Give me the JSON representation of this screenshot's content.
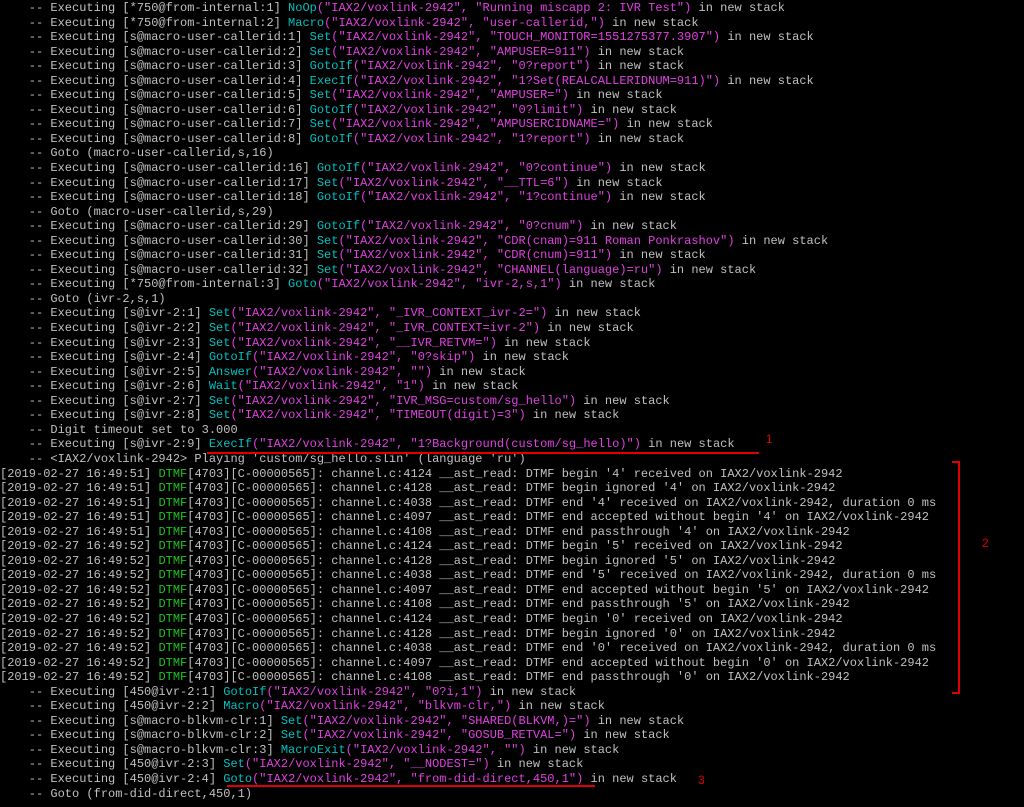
{
  "console": {
    "lines": [
      [
        {
          "t": "    -- Executing [*750@from-internal:1] ",
          "c": "plain"
        },
        {
          "t": "NoOp",
          "c": "app"
        },
        {
          "t": "(\"IAX2/voxlink-2942\", \"Running miscapp 2: IVR Test\")",
          "c": "str"
        },
        {
          "t": " in new stack",
          "c": "plain"
        }
      ],
      [
        {
          "t": "    -- Executing [*750@from-internal:2] ",
          "c": "plain"
        },
        {
          "t": "Macro",
          "c": "app"
        },
        {
          "t": "(\"IAX2/voxlink-2942\", \"user-callerid,\")",
          "c": "str"
        },
        {
          "t": " in new stack",
          "c": "plain"
        }
      ],
      [
        {
          "t": "    -- Executing [s@macro-user-callerid:1] ",
          "c": "plain"
        },
        {
          "t": "Set",
          "c": "app"
        },
        {
          "t": "(\"IAX2/voxlink-2942\", \"TOUCH_MONITOR=1551275377.3907\")",
          "c": "str"
        },
        {
          "t": " in new stack",
          "c": "plain"
        }
      ],
      [
        {
          "t": "    -- Executing [s@macro-user-callerid:2] ",
          "c": "plain"
        },
        {
          "t": "Set",
          "c": "app"
        },
        {
          "t": "(\"IAX2/voxlink-2942\", \"AMPUSER=911\")",
          "c": "str"
        },
        {
          "t": " in new stack",
          "c": "plain"
        }
      ],
      [
        {
          "t": "    -- Executing [s@macro-user-callerid:3] ",
          "c": "plain"
        },
        {
          "t": "GotoIf",
          "c": "app"
        },
        {
          "t": "(\"IAX2/voxlink-2942\", \"0?report\")",
          "c": "str"
        },
        {
          "t": " in new stack",
          "c": "plain"
        }
      ],
      [
        {
          "t": "    -- Executing [s@macro-user-callerid:4] ",
          "c": "plain"
        },
        {
          "t": "ExecIf",
          "c": "app"
        },
        {
          "t": "(\"IAX2/voxlink-2942\", \"1?Set(REALCALLERIDNUM=911)\")",
          "c": "str"
        },
        {
          "t": " in new stack",
          "c": "plain"
        }
      ],
      [
        {
          "t": "    -- Executing [s@macro-user-callerid:5] ",
          "c": "plain"
        },
        {
          "t": "Set",
          "c": "app"
        },
        {
          "t": "(\"IAX2/voxlink-2942\", \"AMPUSER=\")",
          "c": "str"
        },
        {
          "t": " in new stack",
          "c": "plain"
        }
      ],
      [
        {
          "t": "    -- Executing [s@macro-user-callerid:6] ",
          "c": "plain"
        },
        {
          "t": "GotoIf",
          "c": "app"
        },
        {
          "t": "(\"IAX2/voxlink-2942\", \"0?limit\")",
          "c": "str"
        },
        {
          "t": " in new stack",
          "c": "plain"
        }
      ],
      [
        {
          "t": "    -- Executing [s@macro-user-callerid:7] ",
          "c": "plain"
        },
        {
          "t": "Set",
          "c": "app"
        },
        {
          "t": "(\"IAX2/voxlink-2942\", \"AMPUSERCIDNAME=\")",
          "c": "str"
        },
        {
          "t": " in new stack",
          "c": "plain"
        }
      ],
      [
        {
          "t": "    -- Executing [s@macro-user-callerid:8] ",
          "c": "plain"
        },
        {
          "t": "GotoIf",
          "c": "app"
        },
        {
          "t": "(\"IAX2/voxlink-2942\", \"1?report\")",
          "c": "str"
        },
        {
          "t": " in new stack",
          "c": "plain"
        }
      ],
      [
        {
          "t": "    -- Goto (macro-user-callerid,s,16)",
          "c": "plain"
        }
      ],
      [
        {
          "t": "    -- Executing [s@macro-user-callerid:16] ",
          "c": "plain"
        },
        {
          "t": "GotoIf",
          "c": "app"
        },
        {
          "t": "(\"IAX2/voxlink-2942\", \"0?continue\")",
          "c": "str"
        },
        {
          "t": " in new stack",
          "c": "plain"
        }
      ],
      [
        {
          "t": "    -- Executing [s@macro-user-callerid:17] ",
          "c": "plain"
        },
        {
          "t": "Set",
          "c": "app"
        },
        {
          "t": "(\"IAX2/voxlink-2942\", \"__TTL=6\")",
          "c": "str"
        },
        {
          "t": " in new stack",
          "c": "plain"
        }
      ],
      [
        {
          "t": "    -- Executing [s@macro-user-callerid:18] ",
          "c": "plain"
        },
        {
          "t": "GotoIf",
          "c": "app"
        },
        {
          "t": "(\"IAX2/voxlink-2942\", \"1?continue\")",
          "c": "str"
        },
        {
          "t": " in new stack",
          "c": "plain"
        }
      ],
      [
        {
          "t": "    -- Goto (macro-user-callerid,s,29)",
          "c": "plain"
        }
      ],
      [
        {
          "t": "    -- Executing [s@macro-user-callerid:29] ",
          "c": "plain"
        },
        {
          "t": "GotoIf",
          "c": "app"
        },
        {
          "t": "(\"IAX2/voxlink-2942\", \"0?cnum\")",
          "c": "str"
        },
        {
          "t": " in new stack",
          "c": "plain"
        }
      ],
      [
        {
          "t": "    -- Executing [s@macro-user-callerid:30] ",
          "c": "plain"
        },
        {
          "t": "Set",
          "c": "app"
        },
        {
          "t": "(\"IAX2/voxlink-2942\", \"CDR(cnam)=911 Roman Ponkrashov\")",
          "c": "str"
        },
        {
          "t": " in new stack",
          "c": "plain"
        }
      ],
      [
        {
          "t": "    -- Executing [s@macro-user-callerid:31] ",
          "c": "plain"
        },
        {
          "t": "Set",
          "c": "app"
        },
        {
          "t": "(\"IAX2/voxlink-2942\", \"CDR(cnum)=911\")",
          "c": "str"
        },
        {
          "t": " in new stack",
          "c": "plain"
        }
      ],
      [
        {
          "t": "    -- Executing [s@macro-user-callerid:32] ",
          "c": "plain"
        },
        {
          "t": "Set",
          "c": "app"
        },
        {
          "t": "(\"IAX2/voxlink-2942\", \"CHANNEL(language)=ru\")",
          "c": "str"
        },
        {
          "t": " in new stack",
          "c": "plain"
        }
      ],
      [
        {
          "t": "    -- Executing [*750@from-internal:3] ",
          "c": "plain"
        },
        {
          "t": "Goto",
          "c": "app"
        },
        {
          "t": "(\"IAX2/voxlink-2942\", \"ivr-2,s,1\")",
          "c": "str"
        },
        {
          "t": " in new stack",
          "c": "plain"
        }
      ],
      [
        {
          "t": "    -- Goto (ivr-2,s,1)",
          "c": "plain"
        }
      ],
      [
        {
          "t": "    -- Executing [s@ivr-2:1] ",
          "c": "plain"
        },
        {
          "t": "Set",
          "c": "app"
        },
        {
          "t": "(\"IAX2/voxlink-2942\", \"_IVR_CONTEXT_ivr-2=\")",
          "c": "str"
        },
        {
          "t": " in new stack",
          "c": "plain"
        }
      ],
      [
        {
          "t": "    -- Executing [s@ivr-2:2] ",
          "c": "plain"
        },
        {
          "t": "Set",
          "c": "app"
        },
        {
          "t": "(\"IAX2/voxlink-2942\", \"_IVR_CONTEXT=ivr-2\")",
          "c": "str"
        },
        {
          "t": " in new stack",
          "c": "plain"
        }
      ],
      [
        {
          "t": "    -- Executing [s@ivr-2:3] ",
          "c": "plain"
        },
        {
          "t": "Set",
          "c": "app"
        },
        {
          "t": "(\"IAX2/voxlink-2942\", \"__IVR_RETVM=\")",
          "c": "str"
        },
        {
          "t": " in new stack",
          "c": "plain"
        }
      ],
      [
        {
          "t": "    -- Executing [s@ivr-2:4] ",
          "c": "plain"
        },
        {
          "t": "GotoIf",
          "c": "app"
        },
        {
          "t": "(\"IAX2/voxlink-2942\", \"0?skip\")",
          "c": "str"
        },
        {
          "t": " in new stack",
          "c": "plain"
        }
      ],
      [
        {
          "t": "    -- Executing [s@ivr-2:5] ",
          "c": "plain"
        },
        {
          "t": "Answer",
          "c": "app"
        },
        {
          "t": "(\"IAX2/voxlink-2942\", \"\")",
          "c": "str"
        },
        {
          "t": " in new stack",
          "c": "plain"
        }
      ],
      [
        {
          "t": "    -- Executing [s@ivr-2:6] ",
          "c": "plain"
        },
        {
          "t": "Wait",
          "c": "app"
        },
        {
          "t": "(\"IAX2/voxlink-2942\", \"1\")",
          "c": "str"
        },
        {
          "t": " in new stack",
          "c": "plain"
        }
      ],
      [
        {
          "t": "    -- Executing [s@ivr-2:7] ",
          "c": "plain"
        },
        {
          "t": "Set",
          "c": "app"
        },
        {
          "t": "(\"IAX2/voxlink-2942\", \"IVR_MSG=custom/sg_hello\")",
          "c": "str"
        },
        {
          "t": " in new stack",
          "c": "plain"
        }
      ],
      [
        {
          "t": "    -- Executing [s@ivr-2:8] ",
          "c": "plain"
        },
        {
          "t": "Set",
          "c": "app"
        },
        {
          "t": "(\"IAX2/voxlink-2942\", \"TIMEOUT(digit)=3\")",
          "c": "str"
        },
        {
          "t": " in new stack",
          "c": "plain"
        }
      ],
      [
        {
          "t": "    -- Digit timeout set to 3.000",
          "c": "plain"
        }
      ],
      [
        {
          "t": "    -- Executing [s@ivr-2:9] ",
          "c": "plain"
        },
        {
          "t": "ExecIf",
          "c": "app"
        },
        {
          "t": "(\"IAX2/voxlink-2942\", \"1?Background(custom/sg_hello)\")",
          "c": "str"
        },
        {
          "t": " in new stack",
          "c": "plain"
        }
      ],
      [
        {
          "t": "    -- <IAX2/voxlink-2942> Playing 'custom/sg_hello.slin' (language 'ru')",
          "c": "plain"
        }
      ],
      [
        {
          "t": "[2019-02-27 16:49:51] ",
          "c": "plain"
        },
        {
          "t": "DTMF",
          "c": "dtmf"
        },
        {
          "t": "[4703][C-00000565]: channel.c:4124 __ast_read: DTMF begin '4' received on IAX2/voxlink-2942",
          "c": "plain"
        }
      ],
      [
        {
          "t": "[2019-02-27 16:49:51] ",
          "c": "plain"
        },
        {
          "t": "DTMF",
          "c": "dtmf"
        },
        {
          "t": "[4703][C-00000565]: channel.c:4128 __ast_read: DTMF begin ignored '4' on IAX2/voxlink-2942",
          "c": "plain"
        }
      ],
      [
        {
          "t": "[2019-02-27 16:49:51] ",
          "c": "plain"
        },
        {
          "t": "DTMF",
          "c": "dtmf"
        },
        {
          "t": "[4703][C-00000565]: channel.c:4038 __ast_read: DTMF end '4' received on IAX2/voxlink-2942, duration 0 ms",
          "c": "plain"
        }
      ],
      [
        {
          "t": "[2019-02-27 16:49:51] ",
          "c": "plain"
        },
        {
          "t": "DTMF",
          "c": "dtmf"
        },
        {
          "t": "[4703][C-00000565]: channel.c:4097 __ast_read: DTMF end accepted without begin '4' on IAX2/voxlink-2942",
          "c": "plain"
        }
      ],
      [
        {
          "t": "[2019-02-27 16:49:51] ",
          "c": "plain"
        },
        {
          "t": "DTMF",
          "c": "dtmf"
        },
        {
          "t": "[4703][C-00000565]: channel.c:4108 __ast_read: DTMF end passthrough '4' on IAX2/voxlink-2942",
          "c": "plain"
        }
      ],
      [
        {
          "t": "[2019-02-27 16:49:52] ",
          "c": "plain"
        },
        {
          "t": "DTMF",
          "c": "dtmf"
        },
        {
          "t": "[4703][C-00000565]: channel.c:4124 __ast_read: DTMF begin '5' received on IAX2/voxlink-2942",
          "c": "plain"
        }
      ],
      [
        {
          "t": "[2019-02-27 16:49:52] ",
          "c": "plain"
        },
        {
          "t": "DTMF",
          "c": "dtmf"
        },
        {
          "t": "[4703][C-00000565]: channel.c:4128 __ast_read: DTMF begin ignored '5' on IAX2/voxlink-2942",
          "c": "plain"
        }
      ],
      [
        {
          "t": "[2019-02-27 16:49:52] ",
          "c": "plain"
        },
        {
          "t": "DTMF",
          "c": "dtmf"
        },
        {
          "t": "[4703][C-00000565]: channel.c:4038 __ast_read: DTMF end '5' received on IAX2/voxlink-2942, duration 0 ms",
          "c": "plain"
        }
      ],
      [
        {
          "t": "[2019-02-27 16:49:52] ",
          "c": "plain"
        },
        {
          "t": "DTMF",
          "c": "dtmf"
        },
        {
          "t": "[4703][C-00000565]: channel.c:4097 __ast_read: DTMF end accepted without begin '5' on IAX2/voxlink-2942",
          "c": "plain"
        }
      ],
      [
        {
          "t": "[2019-02-27 16:49:52] ",
          "c": "plain"
        },
        {
          "t": "DTMF",
          "c": "dtmf"
        },
        {
          "t": "[4703][C-00000565]: channel.c:4108 __ast_read: DTMF end passthrough '5' on IAX2/voxlink-2942",
          "c": "plain"
        }
      ],
      [
        {
          "t": "[2019-02-27 16:49:52] ",
          "c": "plain"
        },
        {
          "t": "DTMF",
          "c": "dtmf"
        },
        {
          "t": "[4703][C-00000565]: channel.c:4124 __ast_read: DTMF begin '0' received on IAX2/voxlink-2942",
          "c": "plain"
        }
      ],
      [
        {
          "t": "[2019-02-27 16:49:52] ",
          "c": "plain"
        },
        {
          "t": "DTMF",
          "c": "dtmf"
        },
        {
          "t": "[4703][C-00000565]: channel.c:4128 __ast_read: DTMF begin ignored '0' on IAX2/voxlink-2942",
          "c": "plain"
        }
      ],
      [
        {
          "t": "[2019-02-27 16:49:52] ",
          "c": "plain"
        },
        {
          "t": "DTMF",
          "c": "dtmf"
        },
        {
          "t": "[4703][C-00000565]: channel.c:4038 __ast_read: DTMF end '0' received on IAX2/voxlink-2942, duration 0 ms",
          "c": "plain"
        }
      ],
      [
        {
          "t": "[2019-02-27 16:49:52] ",
          "c": "plain"
        },
        {
          "t": "DTMF",
          "c": "dtmf"
        },
        {
          "t": "[4703][C-00000565]: channel.c:4097 __ast_read: DTMF end accepted without begin '0' on IAX2/voxlink-2942",
          "c": "plain"
        }
      ],
      [
        {
          "t": "[2019-02-27 16:49:52] ",
          "c": "plain"
        },
        {
          "t": "DTMF",
          "c": "dtmf"
        },
        {
          "t": "[4703][C-00000565]: channel.c:4108 __ast_read: DTMF end passthrough '0' on IAX2/voxlink-2942",
          "c": "plain"
        }
      ],
      [
        {
          "t": "    -- Executing [450@ivr-2:1] ",
          "c": "plain"
        },
        {
          "t": "GotoIf",
          "c": "app"
        },
        {
          "t": "(\"IAX2/voxlink-2942\", \"0?i,1\")",
          "c": "str"
        },
        {
          "t": " in new stack",
          "c": "plain"
        }
      ],
      [
        {
          "t": "    -- Executing [450@ivr-2:2] ",
          "c": "plain"
        },
        {
          "t": "Macro",
          "c": "app"
        },
        {
          "t": "(\"IAX2/voxlink-2942\", \"blkvm-clr,\")",
          "c": "str"
        },
        {
          "t": " in new stack",
          "c": "plain"
        }
      ],
      [
        {
          "t": "    -- Executing [s@macro-blkvm-clr:1] ",
          "c": "plain"
        },
        {
          "t": "Set",
          "c": "app"
        },
        {
          "t": "(\"IAX2/voxlink-2942\", \"SHARED(BLKVM,)=\")",
          "c": "str"
        },
        {
          "t": " in new stack",
          "c": "plain"
        }
      ],
      [
        {
          "t": "    -- Executing [s@macro-blkvm-clr:2] ",
          "c": "plain"
        },
        {
          "t": "Set",
          "c": "app"
        },
        {
          "t": "(\"IAX2/voxlink-2942\", \"GOSUB_RETVAL=\")",
          "c": "str"
        },
        {
          "t": " in new stack",
          "c": "plain"
        }
      ],
      [
        {
          "t": "    -- Executing [s@macro-blkvm-clr:3] ",
          "c": "plain"
        },
        {
          "t": "MacroExit",
          "c": "app"
        },
        {
          "t": "(\"IAX2/voxlink-2942\", \"\")",
          "c": "str"
        },
        {
          "t": " in new stack",
          "c": "plain"
        }
      ],
      [
        {
          "t": "    -- Executing [450@ivr-2:3] ",
          "c": "plain"
        },
        {
          "t": "Set",
          "c": "app"
        },
        {
          "t": "(\"IAX2/voxlink-2942\", \"__NODEST=\")",
          "c": "str"
        },
        {
          "t": " in new stack",
          "c": "plain"
        }
      ],
      [
        {
          "t": "    -- Executing [450@ivr-2:4] ",
          "c": "plain"
        },
        {
          "t": "Goto",
          "c": "app"
        },
        {
          "t": "(\"IAX2/voxlink-2942\", \"from-did-direct,450,1\")",
          "c": "str"
        },
        {
          "t": " in new stack",
          "c": "plain"
        }
      ],
      [
        {
          "t": "    -- Goto (from-did-direct,450,1)",
          "c": "plain"
        }
      ]
    ]
  },
  "annotations": {
    "label_1": "1",
    "label_2": "2",
    "label_3": "3",
    "color": "#e00000"
  },
  "colors": {
    "background": "#000000",
    "text": "#c0c0c0",
    "application": "#00c0c0",
    "arguments": "#e040e0",
    "dtmf": "#20c020"
  }
}
